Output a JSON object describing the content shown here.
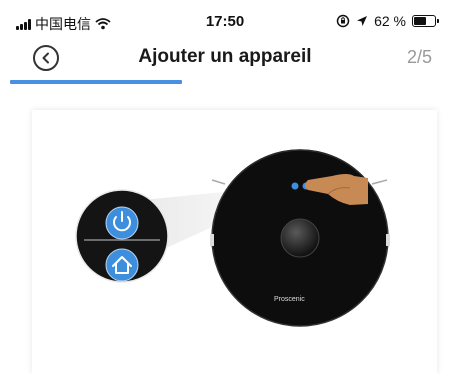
{
  "status_bar": {
    "carrier": "中国电信",
    "time": "17:50",
    "battery_percent": "62 %",
    "battery_level": 0.62
  },
  "nav": {
    "title": "Ajouter un appareil",
    "step": "2/5",
    "back_icon": "chevron-left-circle-icon"
  },
  "progress": {
    "fraction": 0.4
  },
  "illustration": {
    "brand": "Proscenic",
    "icons": [
      "power-icon",
      "home-icon"
    ]
  },
  "colors": {
    "accent": "#4a90e2",
    "robot_body": "#111111",
    "button_blue": "#3e8ede"
  }
}
